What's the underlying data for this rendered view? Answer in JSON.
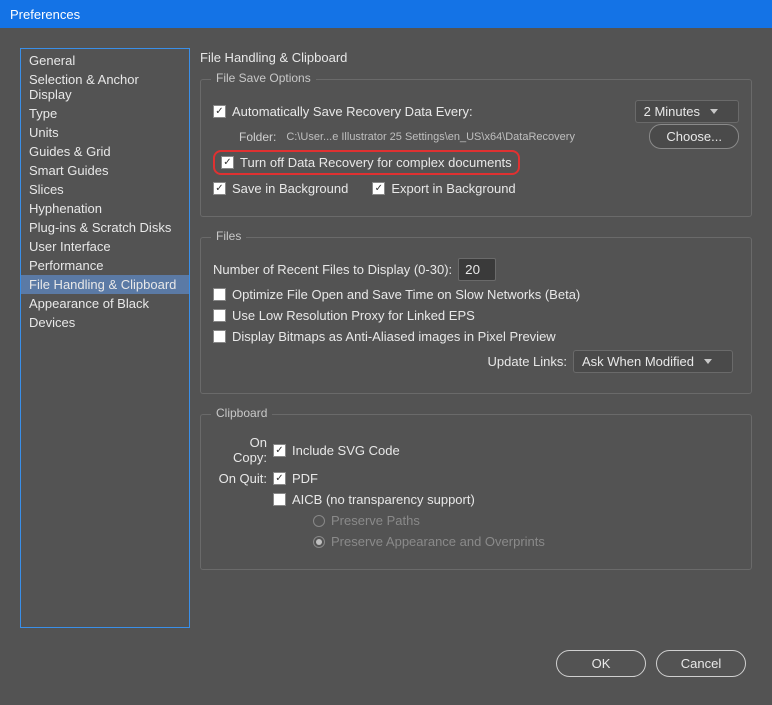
{
  "window": {
    "title": "Preferences"
  },
  "sidebar": {
    "items": [
      {
        "label": "General"
      },
      {
        "label": "Selection & Anchor Display"
      },
      {
        "label": "Type"
      },
      {
        "label": "Units"
      },
      {
        "label": "Guides & Grid"
      },
      {
        "label": "Smart Guides"
      },
      {
        "label": "Slices"
      },
      {
        "label": "Hyphenation"
      },
      {
        "label": "Plug-ins & Scratch Disks"
      },
      {
        "label": "User Interface"
      },
      {
        "label": "Performance"
      },
      {
        "label": "File Handling & Clipboard",
        "selected": true
      },
      {
        "label": "Appearance of Black"
      },
      {
        "label": "Devices"
      }
    ]
  },
  "main": {
    "title": "File Handling & Clipboard",
    "fileSave": {
      "legend": "File Save Options",
      "autoSave": {
        "label": "Automatically Save Recovery Data Every:",
        "checked": true
      },
      "interval": "2 Minutes",
      "folderLabel": "Folder:",
      "folderPath": "C:\\User...e Illustrator 25 Settings\\en_US\\x64\\DataRecovery",
      "chooseBtn": "Choose...",
      "turnOff": {
        "label": "Turn off Data Recovery for complex documents",
        "checked": true
      },
      "saveBg": {
        "label": "Save in Background",
        "checked": true
      },
      "exportBg": {
        "label": "Export in Background",
        "checked": true
      }
    },
    "files": {
      "legend": "Files",
      "recentLabel": "Number of Recent Files to Display (0-30):",
      "recentValue": "20",
      "optimize": {
        "label": "Optimize File Open and Save Time on Slow Networks (Beta)",
        "checked": false
      },
      "lowRes": {
        "label": "Use Low Resolution Proxy for Linked EPS",
        "checked": false
      },
      "bitmap": {
        "label": "Display Bitmaps as Anti-Aliased images in Pixel Preview",
        "checked": false
      },
      "updateLinksLabel": "Update Links:",
      "updateLinksValue": "Ask When Modified"
    },
    "clipboard": {
      "legend": "Clipboard",
      "onCopy": "On Copy:",
      "svg": {
        "label": "Include SVG Code",
        "checked": true
      },
      "onQuit": "On Quit:",
      "pdf": {
        "label": "PDF",
        "checked": true
      },
      "aicb": {
        "label": "AICB (no transparency support)",
        "checked": false
      },
      "preservePaths": {
        "label": "Preserve Paths",
        "checked": false
      },
      "preserveApp": {
        "label": "Preserve Appearance and Overprints",
        "checked": true
      }
    }
  },
  "footer": {
    "ok": "OK",
    "cancel": "Cancel"
  }
}
